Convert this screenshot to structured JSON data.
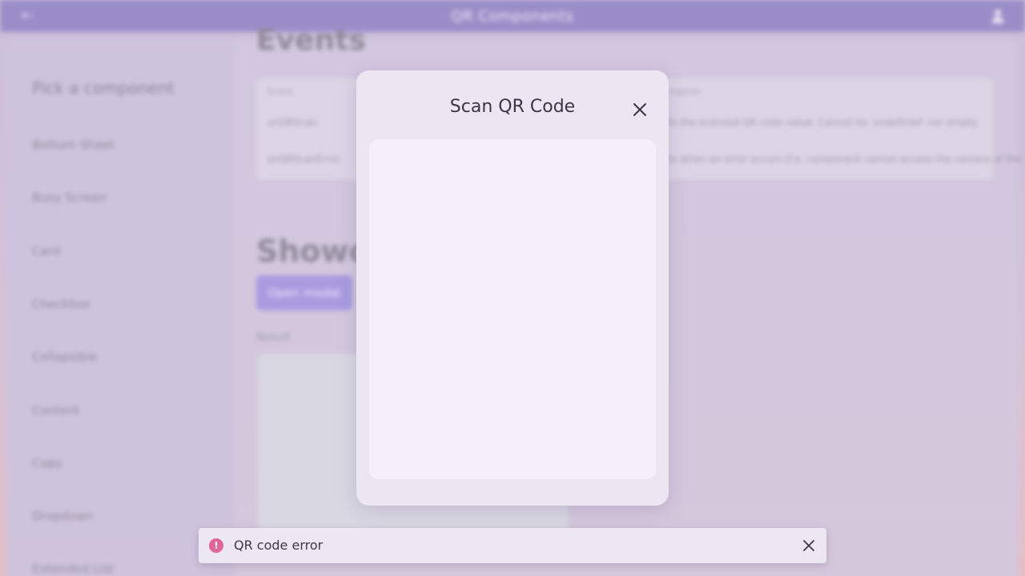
{
  "app": {
    "title": "QR Components"
  },
  "sidebar": {
    "title": "Pick a component",
    "items": [
      {
        "label": "Bottom Sheet"
      },
      {
        "label": "Busy Screen"
      },
      {
        "label": "Card"
      },
      {
        "label": "Checkbox"
      },
      {
        "label": "Collapsible"
      },
      {
        "label": "Content"
      },
      {
        "label": "Copy"
      },
      {
        "label": "Dropdown"
      },
      {
        "label": "Extended List"
      }
    ]
  },
  "main": {
    "heading": "Events",
    "events_table": {
      "headers": [
        "Event",
        "Description"
      ],
      "rows": [
        {
          "event": "onQRScan",
          "description": "Emits the scanned QR code value. Cannot be 'undefined' nor empty."
        },
        {
          "event": "onQRScanError",
          "description": "Emits when an error occurs (f.e. component cannot access the camera of the device)"
        }
      ]
    },
    "showcase_heading": "Showcase",
    "open_modal_label": "Open modal",
    "result_label": "Result"
  },
  "modal": {
    "title": "Scan QR Code"
  },
  "toast": {
    "message": "QR code error"
  },
  "colors": {
    "topbar": "#9a8ec8",
    "accent": "#a89be0",
    "error": "#e0669a",
    "modal_bg": "#ece6f2"
  }
}
